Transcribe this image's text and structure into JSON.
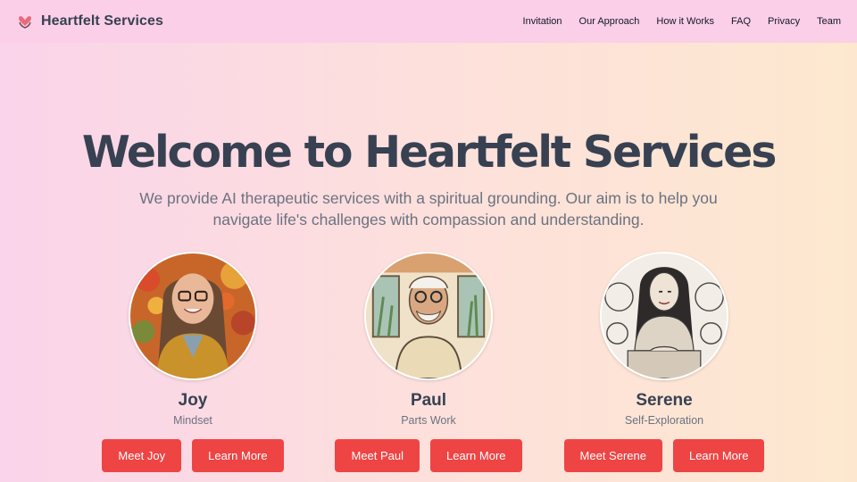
{
  "header": {
    "brand": "Heartfelt Services",
    "brand_icon": "hands-heart-icon",
    "nav": [
      "Invitation",
      "Our Approach",
      "How it Works",
      "FAQ",
      "Privacy",
      "Team"
    ]
  },
  "hero": {
    "title": "Welcome to Heartfelt Services",
    "subtitle": "We provide AI therapeutic services with a spiritual grounding. Our aim is to help you navigate life's challenges with compassion and understanding."
  },
  "team": [
    {
      "name": "Joy",
      "role": "Mindset",
      "primary": "Meet Joy",
      "secondary": "Learn More",
      "icon": "joy-portrait"
    },
    {
      "name": "Paul",
      "role": "Parts Work",
      "primary": "Meet Paul",
      "secondary": "Learn More",
      "icon": "paul-portrait"
    },
    {
      "name": "Serene",
      "role": "Self-Exploration",
      "primary": "Meet Serene",
      "secondary": "Learn More",
      "icon": "serene-portrait"
    }
  ],
  "colors": {
    "accent": "#ef4444",
    "nav_bg": "#fbcfe8",
    "text": "#374151",
    "muted": "#6b7280"
  }
}
